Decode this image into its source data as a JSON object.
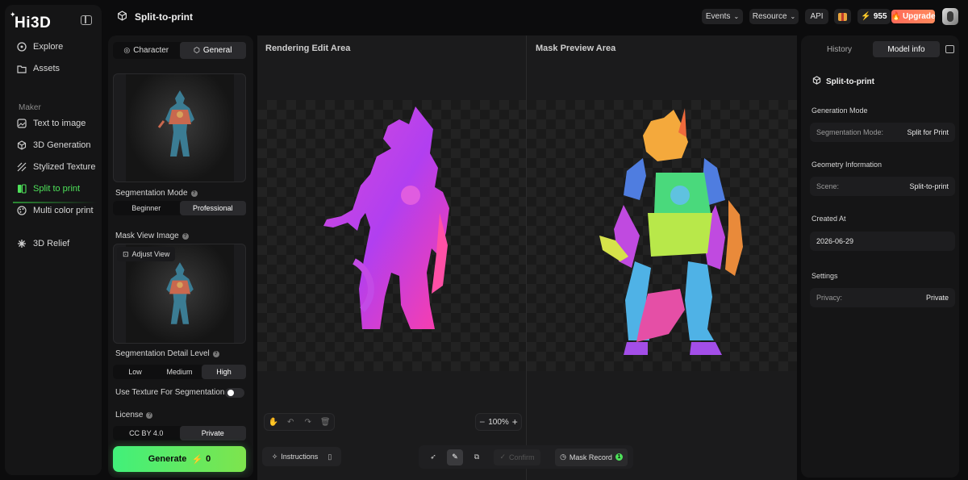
{
  "app": {
    "logo": "Hi3D",
    "page_title": "Split-to-print"
  },
  "sidebar": {
    "items_top": [
      {
        "label": "Explore",
        "icon": "compass-icon"
      },
      {
        "label": "Assets",
        "icon": "folder-icon"
      }
    ],
    "section_label": "Maker",
    "items_maker": [
      {
        "label": "Text to image",
        "icon": "image-icon"
      },
      {
        "label": "3D Generation",
        "icon": "cube-icon"
      },
      {
        "label": "Stylized Texture",
        "icon": "hatch-icon"
      },
      {
        "label": "Split to print",
        "icon": "split-icon",
        "active": true
      },
      {
        "label": "Multi color print",
        "icon": "palette-icon"
      }
    ],
    "items_bottom": [
      {
        "label": "3D Relief",
        "icon": "relief-icon"
      }
    ]
  },
  "topbar": {
    "events": "Events",
    "resource": "Resource",
    "api": "API",
    "credits": "955",
    "upgrade": "Upgrade"
  },
  "left_panel": {
    "tabs": [
      "Character",
      "General"
    ],
    "active_tab": "General",
    "segmentation_mode_label": "Segmentation Mode",
    "segmentation_modes": [
      "Beginner",
      "Professional"
    ],
    "segmentation_mode_selected": "Professional",
    "mask_view_label": "Mask View Image",
    "adjust_view": "Adjust View",
    "detail_level_label": "Segmentation Detail Level",
    "detail_levels": [
      "Low",
      "Medium",
      "High"
    ],
    "detail_level_selected": "High",
    "texture_label": "Use Texture For Segmentation",
    "texture_enabled": false,
    "license_label": "License",
    "licenses": [
      "CC BY 4.0",
      "Private"
    ],
    "license_selected": "Private",
    "generate_label": "Generate",
    "generate_cost": "0"
  },
  "canvas": {
    "left_title": "Rendering Edit Area",
    "right_title": "Mask Preview Area",
    "zoom": "100%",
    "instructions": "Instructions",
    "confirm": "Confirm",
    "mask_record": "Mask Record",
    "mask_record_count": "1"
  },
  "right_panel": {
    "tabs": [
      "History",
      "Model info"
    ],
    "active_tab": "Model info",
    "title": "Split-to-print",
    "generation_mode_label": "Generation Mode",
    "segmentation_mode_key": "Segmentation Mode:",
    "segmentation_mode_value": "Split for Print",
    "geometry_label": "Geometry Information",
    "scene_key": "Scene:",
    "scene_value": "Split-to-print",
    "created_label": "Created At",
    "created_value": "2026-06-29",
    "settings_label": "Settings",
    "privacy_key": "Privacy:",
    "privacy_value": "Private"
  },
  "colors": {
    "accent_green": "#4ee25a",
    "upgrade": "#ff6a5a",
    "panel": "#151516"
  }
}
